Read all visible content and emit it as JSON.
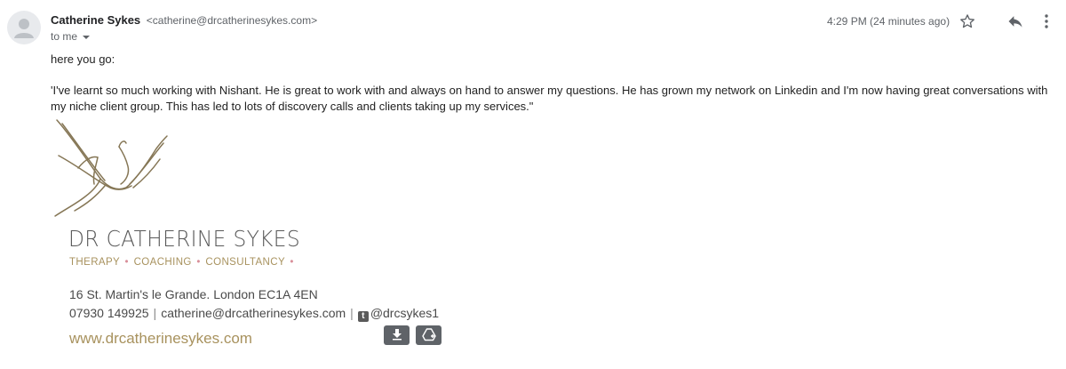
{
  "message": {
    "sender_name": "Catherine Sykes",
    "sender_email": "<catherine@drcatherinesykes.com>",
    "recipient_label": "to me",
    "timestamp": "4:29 PM (24 minutes ago)",
    "greeting": "here you go:",
    "quote": "'I've learnt so much working with Nishant. He is great to work with and always on hand to answer my questions. He has grown my network on Linkedin and I'm now having great conversations with my niche client group. This has led to lots of discovery calls and clients taking up my services.\""
  },
  "signature": {
    "name": "DR CATHERINE SYKES",
    "tagline": {
      "part1": "THERAPY",
      "part2": "COACHING",
      "part3": "CONSULTANCY",
      "dot": "•"
    },
    "address": "16 St. Martin's le Grande. London EC1A 4EN",
    "phone": "07930 149925",
    "email": "catherine@drcatherinesykes.com",
    "separator": "|",
    "twitter_glyph": "t",
    "twitter": "@drcsykes1",
    "website": "www.drcatherinesykes.com"
  },
  "icons": {
    "avatar": "person-icon",
    "star": "star-icon",
    "reply": "reply-icon",
    "more": "more-vert-icon",
    "download": "download-icon",
    "drive": "add-to-drive-icon"
  },
  "colors": {
    "brand_gold": "#a8925e",
    "brand_gray": "#595959",
    "tagline_dot": "#d98f9a",
    "attachment_button": "#5f6368"
  }
}
